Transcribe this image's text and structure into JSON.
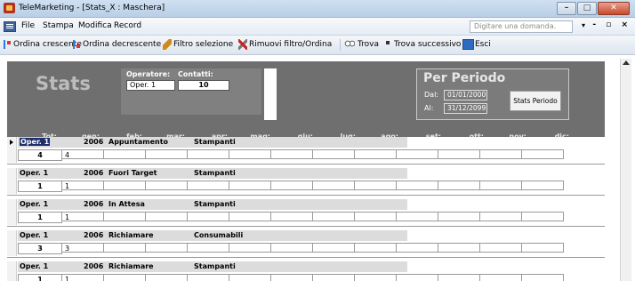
{
  "window": {
    "title": "TeleMarketing - [Stats_X : Maschera]",
    "minimize_glyph": "–",
    "maximize_glyph": "□",
    "close_glyph": "✕"
  },
  "menu": {
    "items": [
      "File",
      "Stampa",
      "Modifica",
      "Record"
    ],
    "help_placeholder": "Digitare una domanda.",
    "help_arrow": "▾",
    "mdi_controls": "- ▫ ×"
  },
  "toolbar": {
    "sort_asc": "Ordina crescente",
    "sort_desc": "Ordina decrescente",
    "filter_selection": "Filtro selezione",
    "remove_filter": "Rimuovi filtro/Ordina",
    "find": "Trova",
    "find_next": "Trova successivo",
    "exit": "Esci"
  },
  "form": {
    "title": "Stats",
    "operator_label": "Operatore:",
    "contacts_label": "Contatti:",
    "operator_value": "Oper. 1",
    "contacts_value": "10",
    "period": {
      "title": "Per Periodo",
      "from_label": "Dal:",
      "from_value": "01/01/2000",
      "to_label": "Al:",
      "to_value": "31/12/2099",
      "button": "Stats Periodo"
    },
    "columns": [
      "Tot:",
      "gen:",
      "feb:",
      "mar:",
      "apr:",
      "mag:",
      "giu:",
      "lug:",
      "ago:",
      "set:",
      "ott:",
      "nov:",
      "dic:"
    ]
  },
  "records": [
    {
      "operator": "Oper. 1",
      "year": "2006",
      "status": "Appuntamento",
      "type": "Stampanti",
      "total": "4",
      "jan": "4",
      "selected": true
    },
    {
      "operator": "Oper. 1",
      "year": "2006",
      "status": "Fuori Target",
      "type": "Stampanti",
      "total": "1",
      "jan": "1",
      "selected": false
    },
    {
      "operator": "Oper. 1",
      "year": "2006",
      "status": "In Attesa",
      "type": "Stampanti",
      "total": "1",
      "jan": "1",
      "selected": false
    },
    {
      "operator": "Oper. 1",
      "year": "2006",
      "status": "Richiamare",
      "type": "Consumabili",
      "total": "3",
      "jan": "3",
      "selected": false
    },
    {
      "operator": "Oper. 1",
      "year": "2006",
      "status": "Richiamare",
      "type": "Stampanti",
      "total": "1",
      "jan": "1",
      "selected": false
    }
  ]
}
